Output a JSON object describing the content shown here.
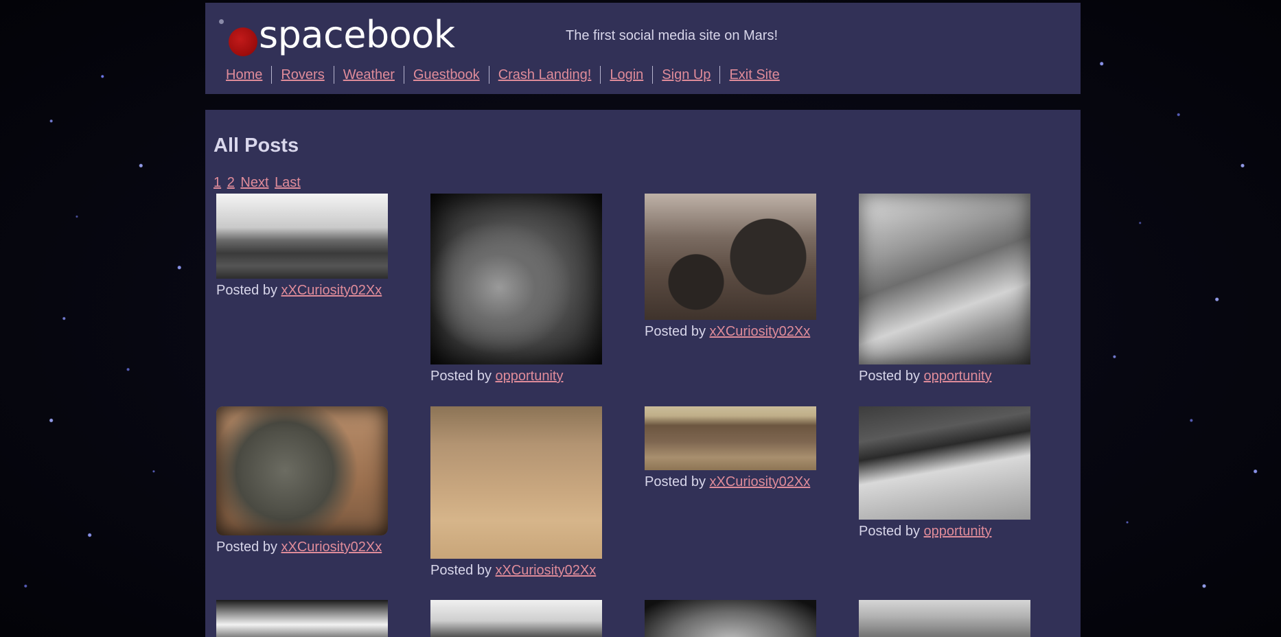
{
  "header": {
    "logo_text": "spacebook",
    "tagline": "The first social media site on Mars!"
  },
  "nav": [
    {
      "label": "Home"
    },
    {
      "label": "Rovers"
    },
    {
      "label": "Weather"
    },
    {
      "label": "Guestbook"
    },
    {
      "label": "Crash Landing!"
    },
    {
      "label": "Login"
    },
    {
      "label": "Sign Up"
    },
    {
      "label": "Exit Site"
    }
  ],
  "main": {
    "title": "All Posts",
    "pagination": [
      "1",
      "2",
      "Next",
      "Last"
    ],
    "posted_by_prefix": "Posted by",
    "posts": [
      {
        "author": "xXCuriosity02Xx"
      },
      {
        "author": "opportunity"
      },
      {
        "author": "xXCuriosity02Xx"
      },
      {
        "author": "opportunity"
      },
      {
        "author": "xXCuriosity02Xx"
      },
      {
        "author": "xXCuriosity02Xx"
      },
      {
        "author": "xXCuriosity02Xx"
      },
      {
        "author": "opportunity"
      }
    ]
  },
  "colors": {
    "panel_bg": "#323157",
    "link": "#e08c9a",
    "text": "#d8d6ea",
    "logo_planet": "#b01414"
  }
}
